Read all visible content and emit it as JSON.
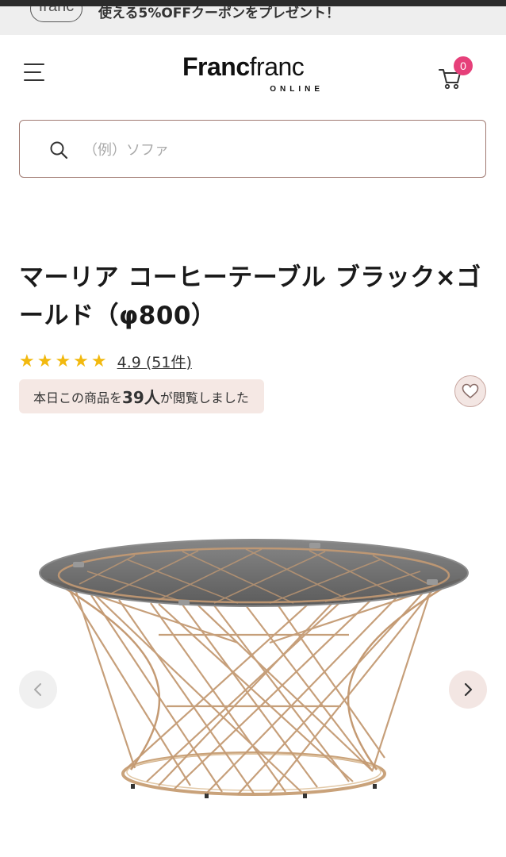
{
  "promo": {
    "logo_text": "franc",
    "text": "使える5%OFFクーポンをプレゼント！"
  },
  "header": {
    "brand_bold": "Franc",
    "brand_light": "franc",
    "brand_sub": "ONLINE",
    "cart_count": "0",
    "menu_icon": "hamburger-icon",
    "cart_icon": "cart-icon"
  },
  "search": {
    "placeholder": "（例）ソファ",
    "value": "",
    "icon": "search-icon"
  },
  "product": {
    "title": "マーリア コーヒーテーブル ブラック×ゴールド（φ800）",
    "stars": "★★★★★",
    "rating_value": 4.9,
    "rating_text": "4.9 (51件)",
    "views_prefix": "本日この商品を",
    "views_count": "39人",
    "views_suffix": "が閲覧しました"
  },
  "gallery": {
    "prev_icon": "chevron-left-icon",
    "next_icon": "chevron-right-icon"
  },
  "colors": {
    "accent": "#e6407a",
    "star": "#f2b90f",
    "pill_bg": "#f5e8e4",
    "search_border": "#a07a72"
  }
}
